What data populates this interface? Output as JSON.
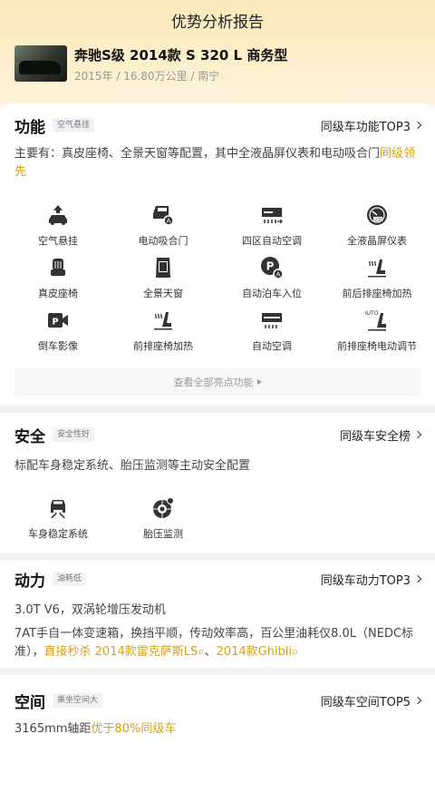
{
  "page": {
    "title": "优势分析报告"
  },
  "car": {
    "name": "奔驰S级 2014款 S 320 L 商务型",
    "meta": "2015年 / 16.80万公里 / 南宁"
  },
  "features": {
    "title": "功能",
    "tag": "空气悬挂",
    "link": "同级车功能TOP3",
    "summary_prefix": "主要有：真皮座椅、全景天窗等配置，其中全液晶屏仪表和电动吸合门",
    "summary_highlight": "同级领先",
    "items": [
      {
        "label": "空气悬挂",
        "icon": "air-suspension-icon"
      },
      {
        "label": "电动吸合门",
        "icon": "soft-close-door-icon"
      },
      {
        "label": "四区自动空调",
        "icon": "four-zone-ac-icon"
      },
      {
        "label": "全液晶屏仪表",
        "icon": "lcd-dashboard-icon"
      },
      {
        "label": "真皮座椅",
        "icon": "leather-seat-icon"
      },
      {
        "label": "全景天窗",
        "icon": "panoramic-sunroof-icon"
      },
      {
        "label": "自动泊车入位",
        "icon": "auto-parking-icon"
      },
      {
        "label": "前后排座椅加热",
        "icon": "seat-heating-icon"
      },
      {
        "label": "倒车影像",
        "icon": "reverse-camera-icon"
      },
      {
        "label": "前排座椅加热",
        "icon": "front-seat-heating-icon"
      },
      {
        "label": "自动空调",
        "icon": "auto-ac-icon"
      },
      {
        "label": "前排座椅电动调节",
        "icon": "power-seat-icon"
      }
    ],
    "more_label": "查看全部亮点功能"
  },
  "safety": {
    "title": "安全",
    "tag": "安全性好",
    "link": "同级车安全榜",
    "summary": "标配车身稳定系统、胎压监测等主动安全配置",
    "items": [
      {
        "label": "车身稳定系统",
        "icon": "stability-control-icon"
      },
      {
        "label": "胎压监测",
        "icon": "tire-pressure-icon"
      }
    ]
  },
  "power": {
    "title": "动力",
    "tag": "油耗低",
    "link": "同级车动力TOP3",
    "engine": "3.0T V6，双涡轮增压发动机",
    "gearbox_text": "7AT手自一体变速箱，换挡平顺，传动效率高，百公里油耗仅8.0L（NEDC标准），",
    "gearbox_highlight": "直接秒杀 2014款雷克萨斯LS",
    "separator": "、",
    "gearbox_highlight2": "2014款Ghibli"
  },
  "space": {
    "title": "空间",
    "tag": "乘坐空间大",
    "link": "同级车空间TOP5",
    "summary_prefix": "3165mm轴距",
    "summary_highlight": "优于80%同级车"
  },
  "colors": {
    "accent": "#d4a017",
    "header_bg": "#fde9b9"
  }
}
